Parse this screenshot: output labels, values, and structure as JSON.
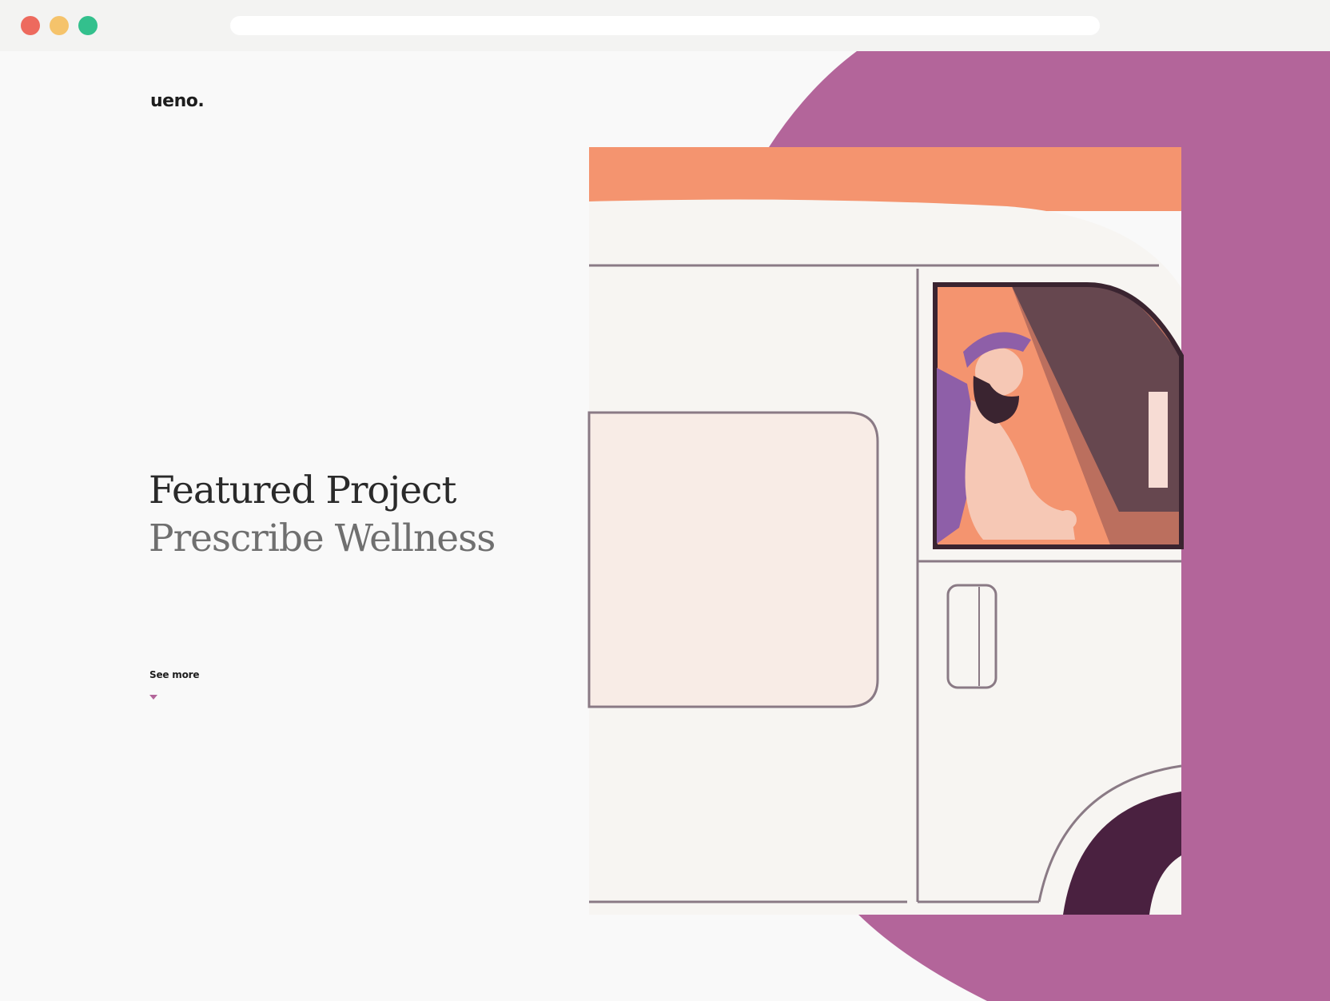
{
  "window": {
    "url": ""
  },
  "brand": {
    "logo": "ueno."
  },
  "hero": {
    "title_line1": "Featured Project",
    "title_line2": "Prescribe Wellness",
    "cta_label": "See more"
  },
  "colors": {
    "accent": "#b3659a",
    "peach": "#f4946f",
    "ink": "#1d1d1d"
  },
  "icons": {
    "cta": "caret-down-icon"
  }
}
